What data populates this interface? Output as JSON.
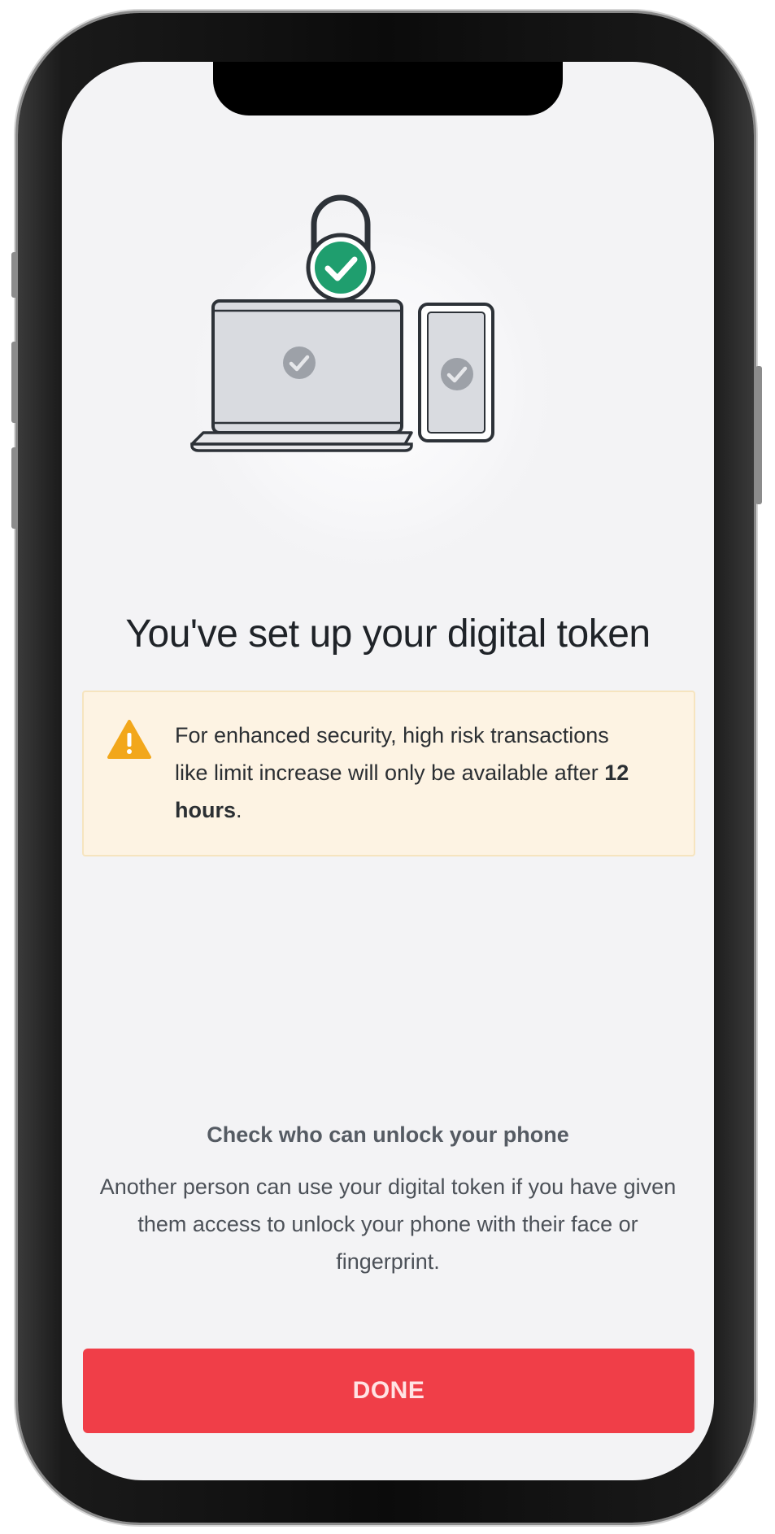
{
  "screen": {
    "title": "You've set up your digital token",
    "warning": {
      "icon": "warning-icon",
      "text_before": "For enhanced security, high risk transactions like limit increase will only be available after ",
      "text_bold": "12 hours",
      "text_after": "."
    },
    "unlock": {
      "heading": "Check who can unlock your phone",
      "description": "Another person can use your digital token if you have given them access to unlock your phone with their face or fingerprint."
    },
    "done_button": "DONE"
  },
  "colors": {
    "primary_button": "#f03e48",
    "lock_badge": "#1f9e6e",
    "warning_background": "#fdf3e3",
    "warning_icon": "#f2a71b",
    "screen_background": "#f3f3f5"
  },
  "illustration": {
    "icons": [
      "lock-icon",
      "check-badge-icon",
      "laptop-icon",
      "phone-icon"
    ]
  }
}
